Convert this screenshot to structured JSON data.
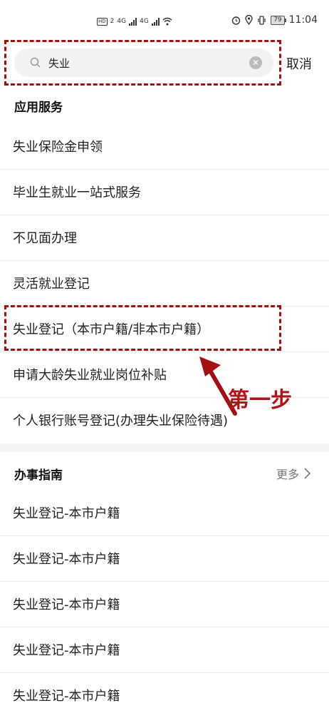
{
  "status_bar": {
    "network_badge": "HD",
    "network_sub": "2",
    "signal1": "4G",
    "signal2": "4G",
    "battery": "79",
    "time": "11:04"
  },
  "search": {
    "query": "失业",
    "cancel_label": "取消"
  },
  "apps_section": {
    "title": "应用服务",
    "items": [
      "失业保险金申领",
      "毕业生就业一站式服务",
      "不见面办理",
      "灵活就业登记",
      "失业登记（本市户籍/非本市户籍）",
      "申请大龄失业就业岗位补贴",
      "个人银行账号登记(办理失业保险待遇)"
    ]
  },
  "guide_section": {
    "title": "办事指南",
    "more_label": "更多",
    "items": [
      "失业登记-本市户籍",
      "失业登记-本市户籍",
      "失业登记-本市户籍",
      "失业登记-本市户籍",
      "失业登记-本市户籍"
    ]
  },
  "annotation": {
    "label": "第一步",
    "color": "#b01419"
  }
}
